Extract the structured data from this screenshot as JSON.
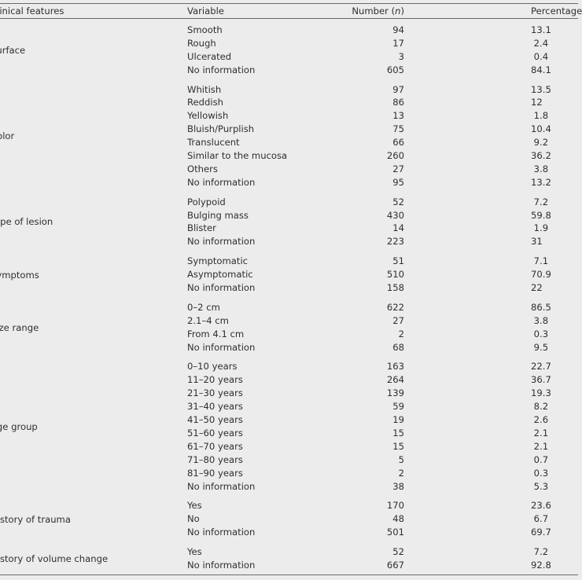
{
  "table": {
    "headers": {
      "feature": "Clinical features",
      "variable": "Variable",
      "number_prefix": "Number (",
      "number_italic": "n",
      "number_suffix": ")",
      "percent": "Percentage (%)"
    },
    "groups": [
      {
        "feature": "Surface",
        "rows": [
          {
            "variable": "Smooth",
            "n": "94",
            "pct": "13.1"
          },
          {
            "variable": "Rough",
            "n": "17",
            "pct": " 2.4"
          },
          {
            "variable": "Ulcerated",
            "n": "3",
            "pct": " 0.4"
          },
          {
            "variable": "No information",
            "n": "605",
            "pct": "84.1"
          }
        ]
      },
      {
        "feature": "Color",
        "rows": [
          {
            "variable": "Whitish",
            "n": "97",
            "pct": "13.5"
          },
          {
            "variable": "Reddish",
            "n": "86",
            "pct": "12"
          },
          {
            "variable": "Yellowish",
            "n": "13",
            "pct": " 1.8"
          },
          {
            "variable": "Bluish/Purplish",
            "n": "75",
            "pct": "10.4"
          },
          {
            "variable": "Translucent",
            "n": "66",
            "pct": " 9.2"
          },
          {
            "variable": "Similar to the mucosa",
            "n": "260",
            "pct": "36.2"
          },
          {
            "variable": "Others",
            "n": "27",
            "pct": " 3.8"
          },
          {
            "variable": "No information",
            "n": "95",
            "pct": "13.2"
          }
        ]
      },
      {
        "feature": "Type of lesion",
        "rows": [
          {
            "variable": "Polypoid",
            "n": "52",
            "pct": " 7.2"
          },
          {
            "variable": "Bulging mass",
            "n": "430",
            "pct": "59.8"
          },
          {
            "variable": "Blister",
            "n": "14",
            "pct": " 1.9"
          },
          {
            "variable": "No information",
            "n": "223",
            "pct": "31"
          }
        ]
      },
      {
        "feature": "Symptoms",
        "rows": [
          {
            "variable": "Symptomatic",
            "n": "51",
            "pct": " 7.1"
          },
          {
            "variable": "Asymptomatic",
            "n": "510",
            "pct": "70.9"
          },
          {
            "variable": "No information",
            "n": "158",
            "pct": "22"
          }
        ]
      },
      {
        "feature": "Size range",
        "rows": [
          {
            "variable": "0–2 cm",
            "n": "622",
            "pct": "86.5"
          },
          {
            "variable": "2.1–4 cm",
            "n": "27",
            "pct": " 3.8"
          },
          {
            "variable": "From 4.1 cm",
            "n": "2",
            "pct": " 0.3"
          },
          {
            "variable": "No information",
            "n": "68",
            "pct": " 9.5"
          }
        ]
      },
      {
        "feature": "Age group",
        "rows": [
          {
            "variable": "0–10 years",
            "n": "163",
            "pct": "22.7"
          },
          {
            "variable": "11–20 years",
            "n": "264",
            "pct": "36.7"
          },
          {
            "variable": "21–30 years",
            "n": "139",
            "pct": "19.3"
          },
          {
            "variable": "31–40 years",
            "n": "59",
            "pct": " 8.2"
          },
          {
            "variable": "41–50 years",
            "n": "19",
            "pct": " 2.6"
          },
          {
            "variable": "51–60 years",
            "n": "15",
            "pct": " 2.1"
          },
          {
            "variable": "61–70 years",
            "n": "15",
            "pct": " 2.1"
          },
          {
            "variable": "71–80 years",
            "n": "5",
            "pct": " 0.7"
          },
          {
            "variable": "81–90 years",
            "n": "2",
            "pct": " 0.3"
          },
          {
            "variable": "No information",
            "n": "38",
            "pct": " 5.3"
          }
        ]
      },
      {
        "feature": "History of trauma",
        "rows": [
          {
            "variable": "Yes",
            "n": "170",
            "pct": "23.6"
          },
          {
            "variable": "No",
            "n": "48",
            "pct": " 6.7"
          },
          {
            "variable": "No information",
            "n": "501",
            "pct": "69.7"
          }
        ]
      },
      {
        "feature": "History of volume change",
        "rows": [
          {
            "variable": "Yes",
            "n": "52",
            "pct": " 7.2"
          },
          {
            "variable": "No information",
            "n": "667",
            "pct": "92.8"
          }
        ]
      }
    ]
  }
}
